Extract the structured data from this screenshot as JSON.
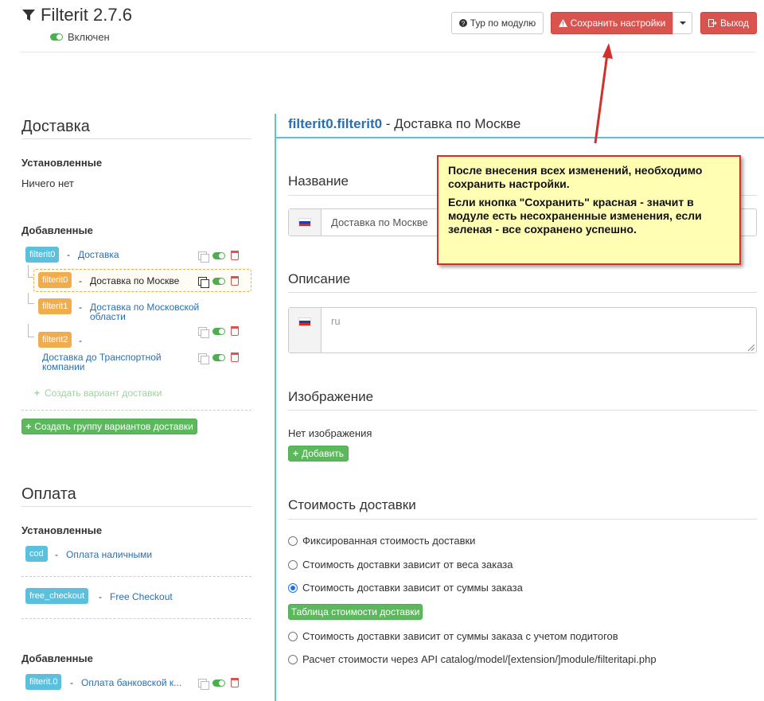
{
  "app": {
    "title": "Filterit 2.7.6",
    "status_label": "Включен"
  },
  "toolbar": {
    "tour_label": "Тур по модулю",
    "save_label": "Сохранить настройки",
    "exit_label": "Выход"
  },
  "colors": {
    "accent": "#5bc0de",
    "danger": "#d9534f",
    "success": "#5cb85c",
    "warning": "#f0ad4e",
    "link": "#2a6fb0"
  },
  "delivery": {
    "title": "Доставка",
    "installed_title": "Установленные",
    "installed_empty": "Ничего нет",
    "added_title": "Добавленные",
    "group": {
      "tag": "filterit0",
      "name": "Доставка"
    },
    "items": [
      {
        "tag": "filterit0",
        "name": "Доставка по Москве"
      },
      {
        "tag": "filterit1",
        "name": "Доставка по Московской области"
      },
      {
        "tag": "filterit2",
        "name": "Доставка до Транспортной компании"
      }
    ],
    "create_variant": "Создать вариант доставки",
    "create_group": "Создать группу вариантов доставки"
  },
  "payment": {
    "title": "Оплата",
    "installed_title": "Установленные",
    "installed": [
      {
        "tag": "cod",
        "name": "Оплата наличными"
      },
      {
        "tag": "free_checkout",
        "name": "Free Checkout"
      }
    ],
    "added_title": "Добавленные",
    "added": [
      {
        "tag": "filterit.0",
        "name": "Оплата банковской к..."
      }
    ]
  },
  "panel": {
    "id": "filterit0.filterit0",
    "title_suffix": " - Доставка по Москве",
    "name_label": "Название",
    "name_value": "Доставка по Москве",
    "description_label": "Описание",
    "description_placeholder": "ru",
    "image_label": "Изображение",
    "no_image": "Нет изображения",
    "add_image": "Добавить",
    "cost_label": "Стоимость доставки",
    "cost_options": [
      "Фиксированная стоимость доставки",
      "Стоимость доставки зависит от веса заказа",
      "Стоимость доставки зависит от суммы заказа",
      "Стоимость доставки зависит от суммы заказа с учетом подитогов",
      "Расчет стоимости через API catalog/model/[extension/]module/filteritapi.php"
    ],
    "cost_selected_index": 2,
    "cost_table_button": "Таблица стоимости доставки"
  },
  "callout": {
    "line1": "После внесения всех изменений, необходимо сохранить настройки.",
    "line2": "Если кнопка \"Сохранить\" красная - значит в модуле есть несохраненные изменения, если зеленая - все сохранено успешно."
  }
}
